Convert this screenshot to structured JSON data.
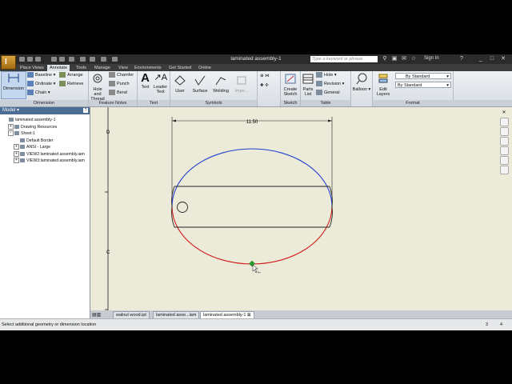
{
  "window": {
    "title": "laminated assembly-1",
    "search_placeholder": "Type a keyword or phrase",
    "signin": "Sign In"
  },
  "tabs": [
    "Place Views",
    "Annotate",
    "Tools",
    "Manage",
    "View",
    "Environments",
    "Get Started",
    "Online"
  ],
  "active_tab": "Annotate",
  "ribbon": {
    "dimension": {
      "big": "Dimension",
      "baseline": "Baseline",
      "ordinate": "Ordinate",
      "chain": "Chain",
      "arrange": "Arrange",
      "retrieve": "Retrieve",
      "label": "Dimension"
    },
    "feature_notes": {
      "hole_thread": "Hole and Thread",
      "chamfer": "Chamfer",
      "punch": "Punch",
      "bend": "Bend",
      "label": "Feature Notes"
    },
    "text": {
      "text": "Text",
      "leader_text": "Leader Text",
      "label": "Text"
    },
    "symbols": {
      "user": "User",
      "surface": "Surface",
      "welding": "Welding",
      "import": "Impo...",
      "label": "Symbols"
    },
    "sketch": {
      "create_sketch": "Create Sketch",
      "label": "Sketch"
    },
    "table": {
      "parts_list": "Parts List",
      "hole": "Hole",
      "revision": "Revision",
      "general": "General",
      "label": "Table"
    },
    "balloon": {
      "balloon": "Balloon"
    },
    "format": {
      "edit_layers": "Edit Layers",
      "combo1": "By Standard",
      "combo2": "By Standard",
      "label": "Format"
    }
  },
  "browser": {
    "header": "Model",
    "tree": [
      {
        "label": "laminated assembly-1",
        "depth": 0,
        "exp": ""
      },
      {
        "label": "Drawing Resources",
        "depth": 1,
        "exp": "+"
      },
      {
        "label": "Sheet:1",
        "depth": 1,
        "exp": "-"
      },
      {
        "label": "Default Border",
        "depth": 2,
        "exp": ""
      },
      {
        "label": "ANSI - Large",
        "depth": 2,
        "exp": "+"
      },
      {
        "label": "VIEW2:laminated assembly.iam",
        "depth": 2,
        "exp": "+"
      },
      {
        "label": "VIEW3:laminated assembly.iam",
        "depth": 2,
        "exp": "+"
      }
    ]
  },
  "drawing": {
    "dimension_value": "11.50",
    "zone_labels": [
      "D",
      "C"
    ],
    "colors": {
      "upper_arc": "#1f3fd0",
      "lower_arc": "#d21a1a",
      "lines": "#222222",
      "point": "#2aa02a"
    }
  },
  "doc_tabs": [
    "walnut wood.ipt",
    "laminated asse...iam",
    "laminated assembly-1"
  ],
  "active_doc_tab": 2,
  "status": {
    "message": "Select additional geometry or dimension location",
    "n1": "3",
    "n2": "4"
  }
}
